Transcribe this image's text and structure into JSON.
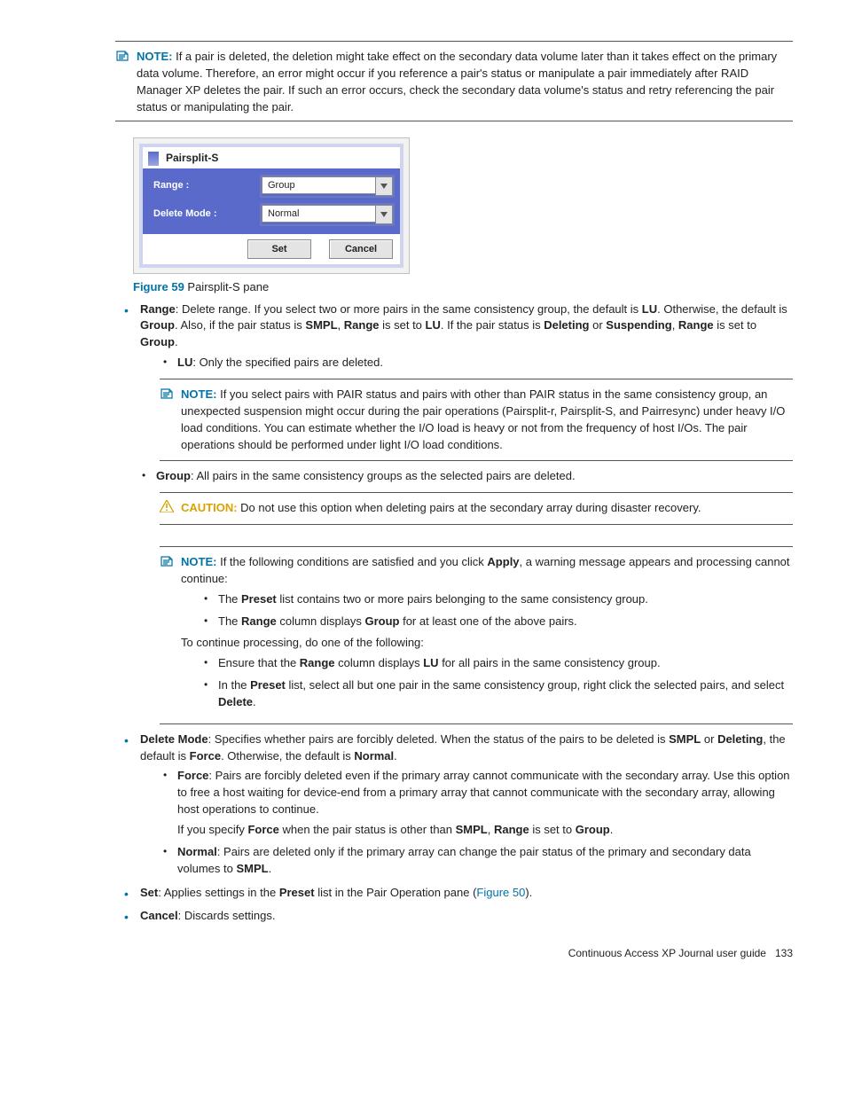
{
  "note1": {
    "label": "NOTE:",
    "text": "If a pair is deleted, the deletion might take effect on the secondary data volume later than it takes effect on the primary data volume. Therefore, an error might occur if you reference a pair's status or manipulate a pair immediately after RAID Manager XP deletes the pair. If such an error occurs, check the secondary data volume's status and retry referencing the pair status or manipulating the pair."
  },
  "figure": {
    "title": "Pairsplit-S",
    "range_label": "Range :",
    "delete_mode_label": "Delete Mode :",
    "range_value": "Group",
    "delete_mode_value": "Normal",
    "set_btn": "Set",
    "cancel_btn": "Cancel",
    "caption_label": "Figure 59",
    "caption_text": " Pairsplit-S pane"
  },
  "range": {
    "term": "Range",
    "text1": ": Delete range. If you select two or more pairs in the same consistency group, the default is ",
    "lu": "LU",
    "text2": ". Otherwise, the default is ",
    "group": "Group",
    "text3": ". Also, if the pair status is ",
    "smpl": "SMPL",
    "text4": ", ",
    "range_b": "Range",
    "text5": " is set to ",
    "text6": ". If the pair status is ",
    "deleting": "Deleting",
    "or": " or ",
    "suspending": "Suspending",
    "text7": ", ",
    "text8": " is set to ",
    "dot": ".",
    "lu_item_b": "LU",
    "lu_item_text": ": Only the specified pairs are deleted."
  },
  "note2": {
    "label": "NOTE:",
    "text": "If you select pairs with PAIR status and pairs with other than PAIR status in the same consistency group, an unexpected suspension might occur during the pair operations (Pairsplit-r, Pairsplit-S, and Pairresync) under heavy I/O load conditions. You can estimate whether the I/O load is heavy or not from the frequency of host I/Os. The pair operations should be performed under light I/O load conditions."
  },
  "group_item": {
    "b": "Group",
    "text": ": All pairs in the same consistency groups as the selected pairs are deleted."
  },
  "caution": {
    "label": "CAUTION:",
    "text": "Do not use this option when deleting pairs at the secondary array during disaster recovery."
  },
  "note3": {
    "label": "NOTE:",
    "t1": "If the following conditions are satisfied and you click ",
    "apply": "Apply",
    "t2": ", a warning message appears and processing cannot continue:",
    "li1a": "The ",
    "preset": "Preset",
    "li1b": " list contains two or more pairs belonging to the same consistency group.",
    "li2a": "The ",
    "range": "Range",
    "li2b": " column displays ",
    "group": "Group",
    "li2c": " for at least one of the above pairs.",
    "cont": "To continue processing, do one of the following:",
    "li3a": "Ensure that the ",
    "li3b": " column displays ",
    "lu": "LU",
    "li3c": " for all pairs in the same consistency group.",
    "li4a": "In the ",
    "li4b": " list, select all but one pair in the same consistency group, right click the selected pairs, and select ",
    "delete": "Delete",
    "dot": "."
  },
  "delete_mode": {
    "term": "Delete Mode",
    "t1": ": Specifies whether pairs are forcibly deleted. When the status of the pairs to be deleted is ",
    "smpl": "SMPL",
    "or": " or ",
    "deleting": "Deleting",
    "t2": ", the default is ",
    "force": "Force",
    "t3": ". Otherwise, the default is ",
    "normal": "Normal",
    "dot": ".",
    "force_b": "Force",
    "force_text": ": Pairs are forcibly deleted even if the primary array cannot communicate with the secondary array. Use this option to free a host waiting for device-end from a primary array that cannot communicate with the secondary array, allowing host operations to continue.",
    "force_extra1": "If you specify ",
    "force_extra2": " when the pair status is other than ",
    "force_extra3": ", ",
    "range": "Range",
    "force_extra4": " is set to ",
    "group": "Group",
    "normal_b": "Normal",
    "normal_text": ": Pairs are deleted only if the primary array can change the pair status of the primary and secondary data volumes to "
  },
  "set_item": {
    "b": "Set",
    "t1": ": Applies settings in the ",
    "preset": "Preset",
    "t2": " list in the Pair Operation pane (",
    "link": "Figure 50",
    "t3": ")."
  },
  "cancel_item": {
    "b": "Cancel",
    "text": ": Discards settings."
  },
  "footer": {
    "text": "Continuous Access XP Journal user guide",
    "page": "133"
  }
}
